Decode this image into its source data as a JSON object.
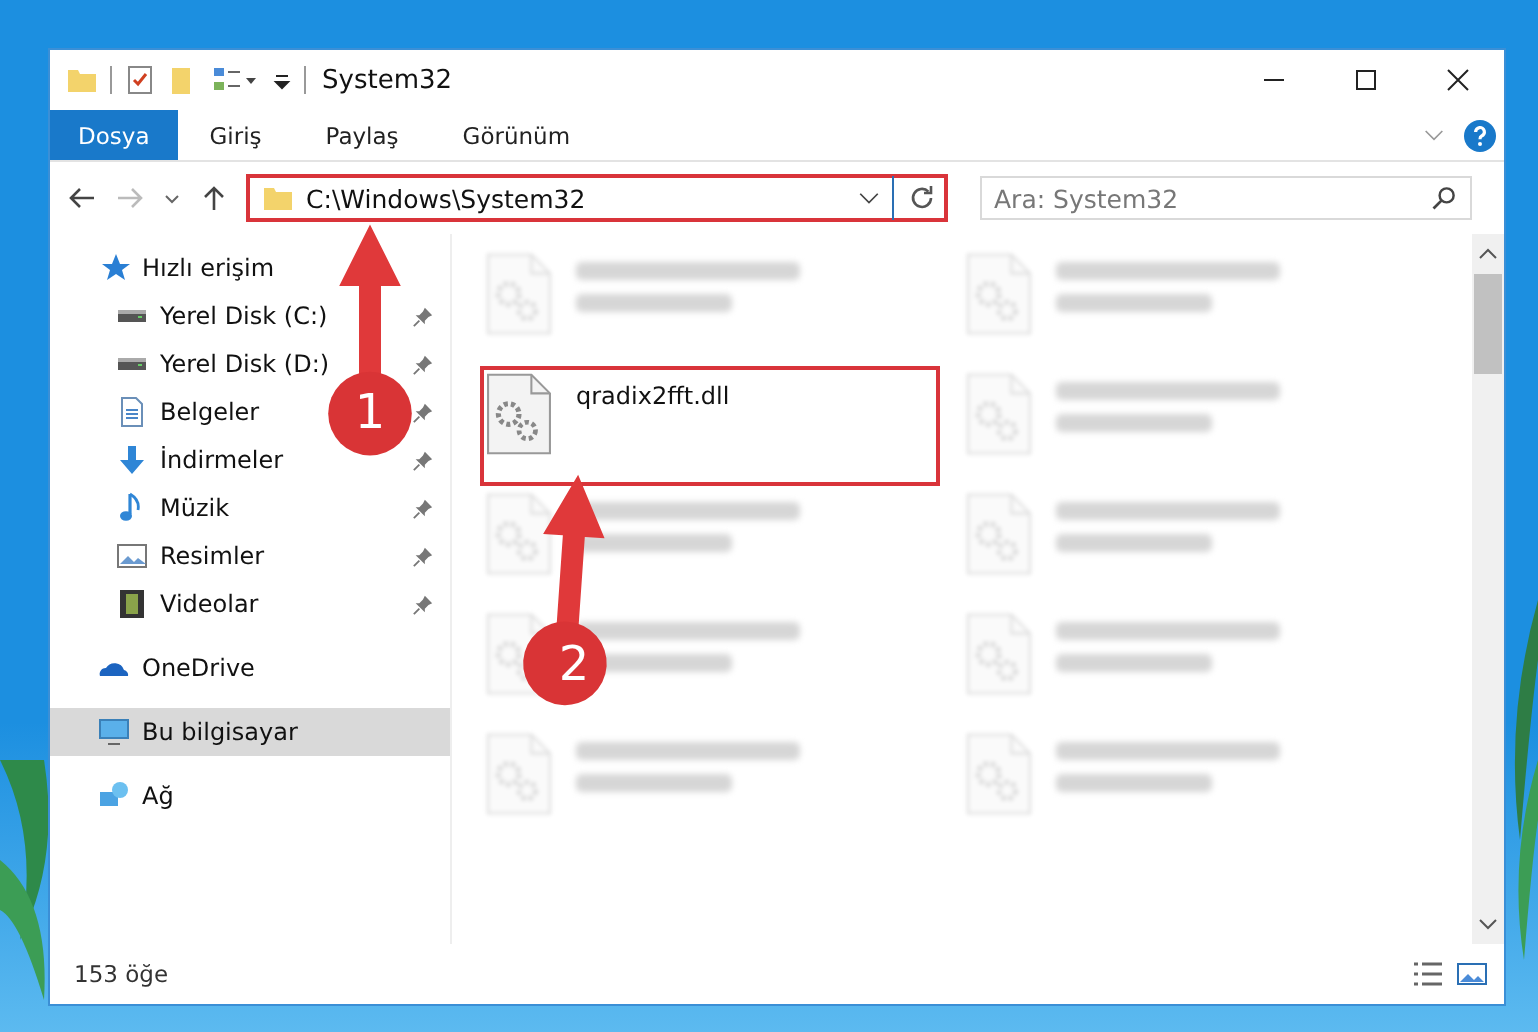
{
  "window": {
    "title": "System32"
  },
  "tabs": [
    {
      "label": "Dosya",
      "selected": true
    },
    {
      "label": "Giriş",
      "selected": false
    },
    {
      "label": "Paylaş",
      "selected": false
    },
    {
      "label": "Görünüm",
      "selected": false
    }
  ],
  "address": {
    "value": "C:\\Windows\\System32",
    "highlighted": true
  },
  "search": {
    "placeholder": "Ara: System32"
  },
  "sidebar": {
    "items": [
      {
        "label": "Hızlı erişim",
        "kind": "star",
        "group": true,
        "pinned": false,
        "selected": false
      },
      {
        "label": "Yerel Disk (C:)",
        "kind": "disk",
        "group": false,
        "pinned": true,
        "selected": false
      },
      {
        "label": "Yerel Disk (D:)",
        "kind": "disk",
        "group": false,
        "pinned": true,
        "selected": false
      },
      {
        "label": "Belgeler",
        "kind": "doc",
        "group": false,
        "pinned": true,
        "selected": false
      },
      {
        "label": "İndirmeler",
        "kind": "download",
        "group": false,
        "pinned": true,
        "selected": false
      },
      {
        "label": "Müzik",
        "kind": "music",
        "group": false,
        "pinned": true,
        "selected": false
      },
      {
        "label": "Resimler",
        "kind": "image",
        "group": false,
        "pinned": true,
        "selected": false
      },
      {
        "label": "Videolar",
        "kind": "video",
        "group": false,
        "pinned": true,
        "selected": false
      },
      {
        "label": "OneDrive",
        "kind": "cloud",
        "group": true,
        "pinned": false,
        "selected": false
      },
      {
        "label": "Bu bilgisayar",
        "kind": "pc",
        "group": true,
        "pinned": false,
        "selected": true
      },
      {
        "label": "Ağ",
        "kind": "network",
        "group": true,
        "pinned": false,
        "selected": false
      }
    ]
  },
  "files": [
    {
      "kind": "blurred"
    },
    {
      "kind": "blurred"
    },
    {
      "kind": "file",
      "name": "qradix2fft.dll",
      "highlighted": true
    },
    {
      "kind": "blurred"
    },
    {
      "kind": "blurred"
    },
    {
      "kind": "blurred"
    },
    {
      "kind": "blurred"
    },
    {
      "kind": "blurred"
    },
    {
      "kind": "blurred"
    },
    {
      "kind": "blurred"
    }
  ],
  "status_bar": {
    "count": "153 öğe"
  },
  "annotations": [
    {
      "number": "1"
    },
    {
      "number": "2"
    }
  ]
}
